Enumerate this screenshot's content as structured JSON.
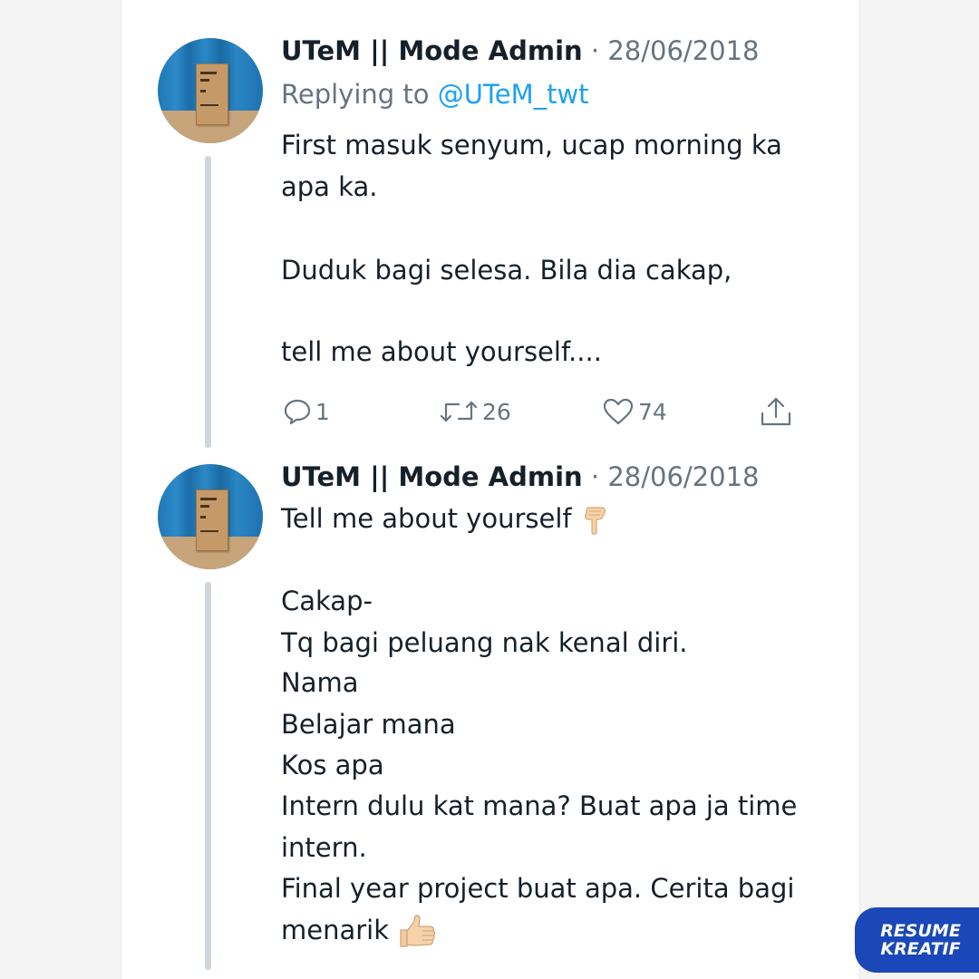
{
  "tweets": [
    {
      "author": "UTeM || Mode Admin",
      "separator": "·",
      "date": "28/06/2018",
      "replying_prefix": "Replying to ",
      "replying_handle": "@UTeM_twt",
      "lines": [
        "First masuk senyum, ucap morning ka",
        "apa ka.",
        "Duduk bagi selesa. Bila dia cakap,",
        "tell me about yourself...."
      ],
      "actions": {
        "reply_count": "1",
        "retweet_count": "26",
        "like_count": "74"
      }
    },
    {
      "author": "UTeM || Mode Admin",
      "separator": "·",
      "date": "28/06/2018",
      "lines": [
        "Tell me about yourself",
        "Cakap-",
        "Tq bagi peluang nak kenal diri.",
        "Nama",
        "Belajar mana",
        "Kos apa",
        "Intern dulu kat mana? Buat apa ja time",
        "intern.",
        "Final year project buat apa. Cerita bagi",
        "menarik"
      ]
    }
  ],
  "icons": {
    "reply": "speech-bubble-icon",
    "retweet": "retweet-icon",
    "like": "heart-icon",
    "share": "share-icon",
    "point_down": "point-down-emoji",
    "thumbs_up": "thumbs-up-emoji"
  },
  "watermark": {
    "line1": "RESUME",
    "line2": "KREATIF"
  },
  "colors": {
    "link": "#1da1f2",
    "muted": "#67747f",
    "text": "#16202b",
    "badge": "#1a48b8"
  }
}
